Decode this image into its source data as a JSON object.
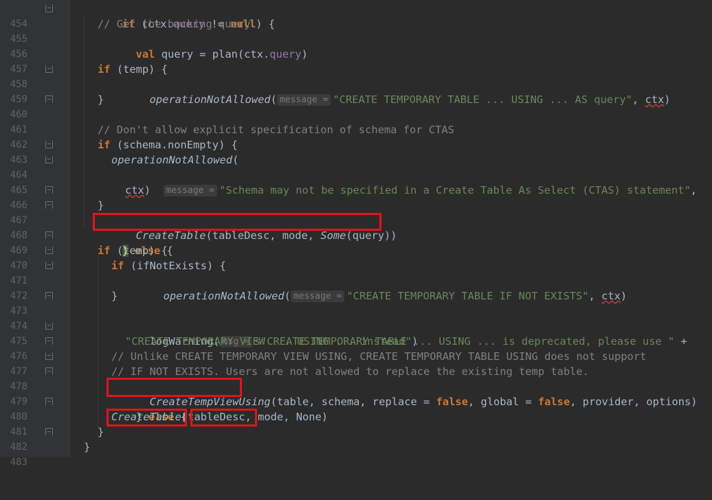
{
  "line_numbers": [
    "454",
    "455",
    "456",
    "457",
    "458",
    "459",
    "460",
    "461",
    "462",
    "463",
    "464",
    "465",
    "466",
    "467",
    "468",
    "469",
    "470",
    "471",
    "472",
    "473",
    "474",
    "475",
    "476",
    "477",
    "478",
    "479",
    "480",
    "481",
    "482",
    "483"
  ],
  "code": {
    "l454": {
      "if": "if",
      "p1": " (ctx.",
      "query": "query",
      "p2": " != ",
      "null": "null",
      "p3": ") {"
    },
    "l455": {
      "cm": "// Get the backing query."
    },
    "l456": {
      "val": "val",
      "p1": " query = plan(ctx.",
      "query": "query",
      "p2": ")"
    },
    "l458": {
      "if": "if",
      "p1": " (temp) {"
    },
    "l459": {
      "fn": "operationNotAllowed",
      "p1": "(",
      "hint": "message =",
      "str": "\"CREATE TEMPORARY TABLE ... USING ... AS query\"",
      "p2": ", ",
      "ctx": "ctx",
      "p3": ")"
    },
    "l460": {
      "p1": "}"
    },
    "l462": {
      "cm": "// Don't allow explicit specification of schema for CTAS"
    },
    "l463": {
      "if": "if",
      "p1": " (schema.nonEmpty) {"
    },
    "l464": {
      "fn": "operationNotAllowed",
      "p1": "("
    },
    "l465": {
      "hint": "message =",
      "str": "\"Schema may not be specified in a Create Table As Select (CTAS) statement\"",
      "p1": ","
    },
    "l466": {
      "ctx": "ctx",
      "p1": ")"
    },
    "l467": {
      "p1": "}"
    },
    "l468": {
      "fn": "CreateTable",
      "p1": "(tableDesc, mode, ",
      "some": "Some",
      "p2": "(query))"
    },
    "l469": {
      "p1": "}",
      "else": "else",
      "p2": " {"
    },
    "l470": {
      "if": "if",
      "p1": " (temp) {"
    },
    "l471": {
      "if": "if",
      "p1": " (ifNotExists) {"
    },
    "l472": {
      "fn": "operationNotAllowed",
      "p1": "(",
      "hint": "message =",
      "str": "\"CREATE TEMPORARY TABLE IF NOT EXISTS\"",
      "p2": ", ",
      "ctx": "ctx",
      "p3": ")"
    },
    "l473": {
      "p1": "}"
    },
    "l475": {
      "fn": "logWarning",
      "p1": "(",
      "hint": "msg =",
      "str": "s\"CREATE TEMPORARY TABLE ... USING ... is deprecated, please use \"",
      "p2": " +"
    },
    "l476": {
      "str": "\"CREATE TEMPORARY VIEW ... USING ... instead\"",
      "p1": ")"
    },
    "l477": {
      "cm": "// Unlike CREATE TEMPORARY VIEW USING, CREATE TEMPORARY TABLE USING does not support"
    },
    "l478": {
      "cm": "// IF NOT EXISTS. Users are not allowed to replace the existing temp table."
    },
    "l479": {
      "fn": "CreateTempViewUsing",
      "p1": "(table, schema, replace = ",
      "false1": "false",
      "p2": ", global = ",
      "false2": "false",
      "p3": ", provider, options)"
    },
    "l480": {
      "p1": "}",
      "else": "else",
      "p2": " {"
    },
    "l481": {
      "fn": "CreateTable",
      "p1": "(tableDesc, mode, None)"
    },
    "l482": {
      "p1": "}"
    },
    "l483": {
      "p1": "}"
    }
  },
  "colors": {
    "background": "#2b2b2b",
    "keyword": "#cc7832",
    "string": "#6a8759",
    "comment": "#808080",
    "highlight_box": "#e1141c"
  }
}
